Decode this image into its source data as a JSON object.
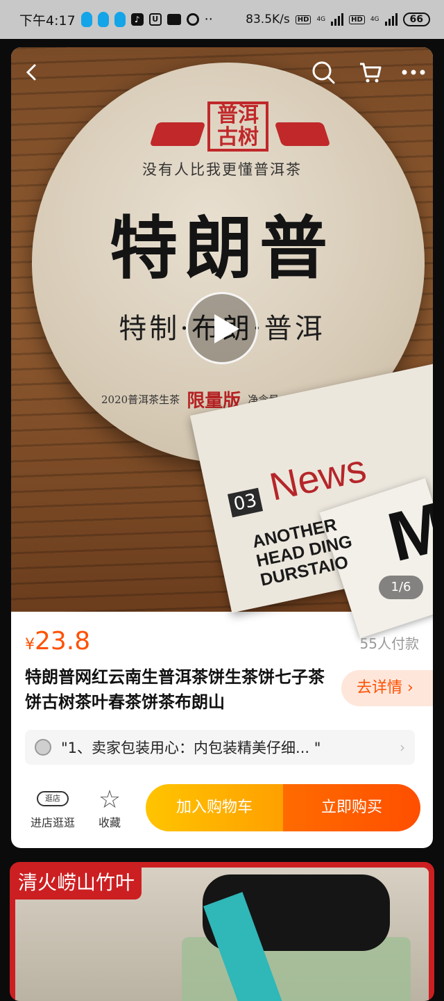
{
  "status_bar": {
    "time": "下午4:17",
    "net_speed": "83.5K/s",
    "hd1": "HD",
    "net1": "4G",
    "hd2": "HD",
    "net2": "4G",
    "battery": "66"
  },
  "hero": {
    "slogan": "没有人比我更懂普洱茶",
    "seal_text": "普洱古树",
    "brand": "特朗普",
    "subtitle": "特制·布朗·普洱",
    "foot_left": "2020普洱茶生茶",
    "foot_limited": "限量版",
    "foot_right": "净含量：357克",
    "news_number": "03",
    "news_word": "News",
    "news_headline": "ANOTHER HEAD DING DURSTAIO",
    "news_big_letter": "M",
    "image_counter": "1/6"
  },
  "product": {
    "currency": "¥",
    "price": "23.8",
    "sold": "55人付款",
    "title": "特朗普网红云南生普洱茶饼生茶饼七子茶饼古树茶叶春茶饼茶布朗山",
    "detail_button": "去详情 ›",
    "review": "\"1、卖家包装用心：内包装精美仔细...  \"",
    "shop_icon_text": "逛店",
    "shop_label": "进店逛逛",
    "favorite_label": "收藏",
    "cart_button": "加入购物车",
    "buy_button": "立即购买"
  },
  "next_item": {
    "tag": "清火崂山竹叶"
  },
  "colors": {
    "accent": "#ff5000",
    "cart": "#ffb000",
    "buy": "#ff5500",
    "next_card": "#cc1f22"
  },
  "icons": [
    "back-icon",
    "search-icon",
    "cart-icon",
    "more-icon",
    "play-icon",
    "star-icon",
    "chevron-right-icon"
  ]
}
